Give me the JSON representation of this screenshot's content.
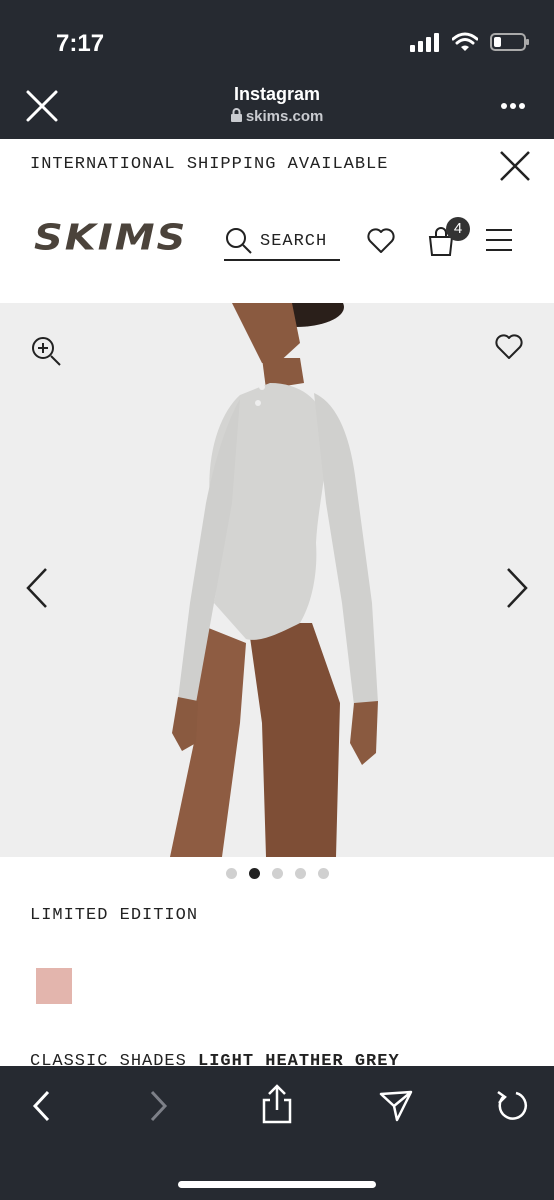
{
  "status_bar": {
    "time": "7:17"
  },
  "browser": {
    "title": "Instagram",
    "url": "skims.com"
  },
  "promo": {
    "text": "INTERNATIONAL SHIPPING AVAILABLE"
  },
  "header": {
    "logo": "SKIMS",
    "search_label": "SEARCH",
    "cart_count": "4"
  },
  "product": {
    "edition": "LIMITED EDITION",
    "swatch_color": "#e3b5ad",
    "shades_prefix": "CLASSIC SHADES",
    "shade_name": "LIGHT HEATHER GREY",
    "image_dots": 5,
    "active_dot": 2
  },
  "colors": {
    "browser_chrome": "#262a31",
    "hero_background": "#eeeeee",
    "logo": "#4b433b"
  }
}
